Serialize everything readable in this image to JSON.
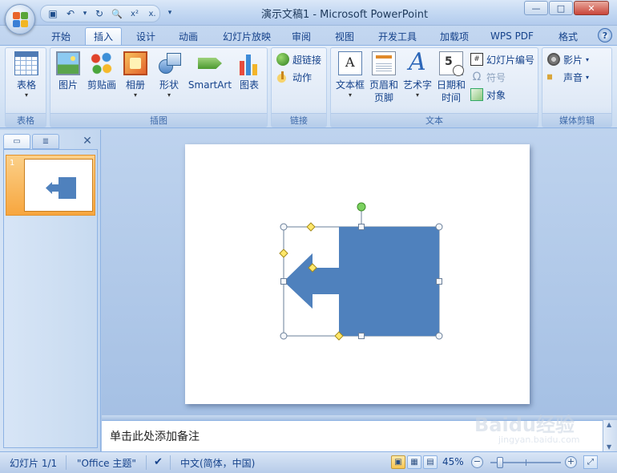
{
  "window": {
    "title": "演示文稿1 - Microsoft PowerPoint",
    "controls": {
      "minimize": "—",
      "maximize": "□",
      "close": "✕"
    }
  },
  "quick_access": {
    "items": [
      {
        "icon": "save-icon",
        "glyph": "▣"
      },
      {
        "icon": "undo-icon",
        "glyph": "↶"
      },
      {
        "icon": "undo-dropdown-icon",
        "glyph": "▾"
      },
      {
        "icon": "redo-icon",
        "glyph": "↻"
      },
      {
        "icon": "print-preview-icon",
        "glyph": "🔍"
      },
      {
        "icon": "custom-x2-icon",
        "glyph": "x²"
      },
      {
        "icon": "custom-x-icon",
        "glyph": "x."
      }
    ],
    "customize_glyph": "▾"
  },
  "tabs": [
    {
      "label": "开始",
      "active": false
    },
    {
      "label": "插入",
      "active": true
    },
    {
      "label": "设计",
      "active": false
    },
    {
      "label": "动画",
      "active": false
    },
    {
      "label": "幻灯片放映",
      "active": false
    },
    {
      "label": "审阅",
      "active": false
    },
    {
      "label": "视图",
      "active": false
    },
    {
      "label": "开发工具",
      "active": false
    },
    {
      "label": "加载项",
      "active": false
    },
    {
      "label": "WPS PDF",
      "active": false
    },
    {
      "label": "格式",
      "active": false
    }
  ],
  "help_label": "?",
  "ribbon": {
    "groups": {
      "table": {
        "label": "表格",
        "buttons": {
          "table": "表格"
        }
      },
      "illustrations": {
        "label": "插图",
        "buttons": {
          "picture": "图片",
          "clipart": "剪贴画",
          "album": "相册",
          "shapes": "形状",
          "smartart": "SmartArt",
          "chart": "图表"
        }
      },
      "links": {
        "label": "链接",
        "buttons": {
          "hyperlink": "超链接",
          "action": "动作"
        }
      },
      "text": {
        "label": "文本",
        "buttons": {
          "textbox": "文本框",
          "header_footer_1": "页眉和",
          "header_footer_2": "页脚",
          "wordart": "艺术字",
          "datetime_1": "日期和",
          "datetime_2": "时间",
          "slide_number": "幻灯片编号",
          "symbol": "符号",
          "object": "对象"
        }
      },
      "media": {
        "label": "媒体剪辑",
        "buttons": {
          "movie": "影片",
          "sound": "声音"
        }
      }
    },
    "caret": "▾"
  },
  "left_pane": {
    "tab_slides_glyph": "▭",
    "tab_outline_glyph": "≣",
    "close_glyph": "✕",
    "slides": [
      {
        "number": "1"
      }
    ]
  },
  "notes": {
    "placeholder": "单击此处添加备注"
  },
  "status": {
    "slide": "幻灯片 1/1",
    "theme": "\"Office 主题\"",
    "language": "中文(简体，中国)",
    "zoom": "45%",
    "zoom_level": 0.45,
    "view_glyphs": [
      "▣",
      "▦",
      "▤"
    ],
    "zoom_minus": "−",
    "zoom_plus": "+",
    "fit_glyph": "⤢"
  },
  "watermark": {
    "main": "Baidu经验",
    "sub": "jingyan.baidu.com"
  },
  "colors": {
    "accent": "#15428b",
    "shape_fill": "#4f81bd",
    "active_tab": "#e3edf9",
    "selected_thumbnail": "#f7a63f"
  }
}
